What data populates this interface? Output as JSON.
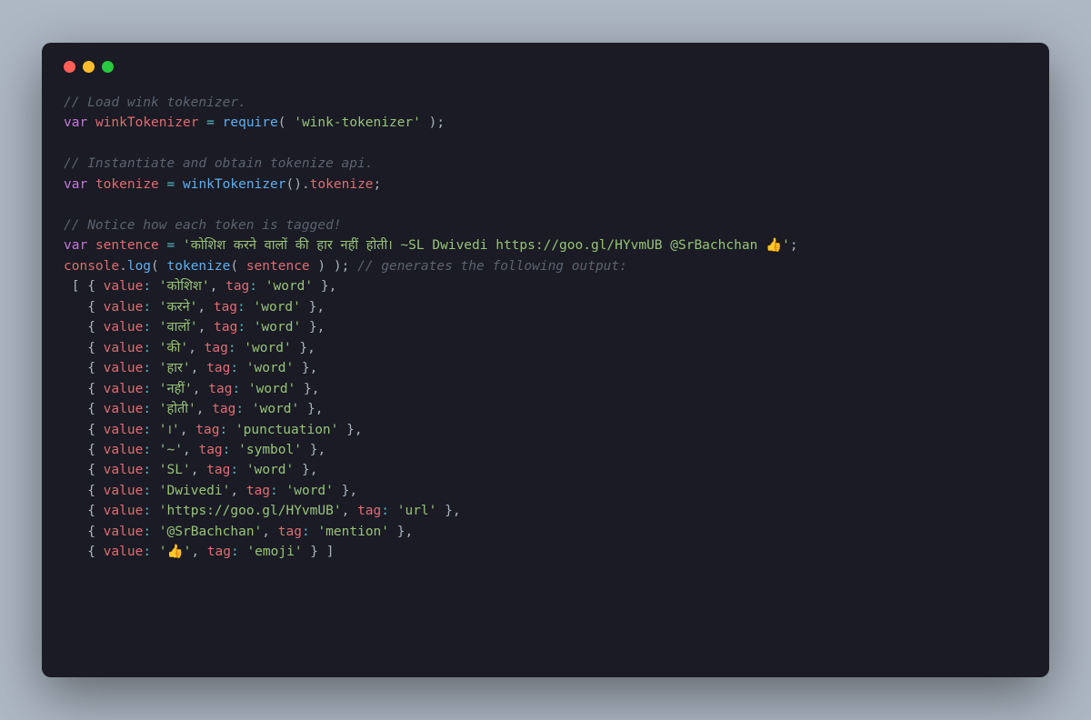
{
  "window": {
    "dots": [
      "red",
      "yellow",
      "green"
    ]
  },
  "code": {
    "c1": "// Load wink tokenizer.",
    "l2": {
      "kw": "var",
      "sp": " ",
      "v": "winkTokenizer",
      "eq": " = ",
      "fn": "require",
      "op": "( ",
      "str": "'wink-tokenizer'",
      "cp": " );"
    },
    "c3": "// Instantiate and obtain tokenize api.",
    "l4": {
      "kw": "var",
      "sp": " ",
      "v": "tokenize",
      "eq": " = ",
      "fn": "winkTokenizer",
      "call": "().",
      "prop": "tokenize",
      "end": ";"
    },
    "c5": "// Notice how each token is tagged!",
    "l6": {
      "kw": "var",
      "sp": " ",
      "v": "sentence",
      "eq": " = ",
      "str": "'कोशिश करने वालों की हार नहीं होती। ~SL Dwivedi https://goo.gl/HYvmUB @SrBachchan 👍'",
      "end": ";"
    },
    "l7": {
      "obj": "console",
      "dot": ".",
      "fn": "log",
      "op": "( ",
      "fn2": "tokenize",
      "op2": "( ",
      "arg": "sentence",
      "cp": " ) );",
      "sp": " ",
      "cmt": "// generates the following output:"
    },
    "out": {
      "open": " [ ",
      "rows": [
        {
          "v": "'कोशिश'",
          "t": "'word'"
        },
        {
          "v": "'करने'",
          "t": "'word'"
        },
        {
          "v": "'वालों'",
          "t": "'word'"
        },
        {
          "v": "'की'",
          "t": "'word'"
        },
        {
          "v": "'हार'",
          "t": "'word'"
        },
        {
          "v": "'नहीं'",
          "t": "'word'"
        },
        {
          "v": "'होती'",
          "t": "'word'"
        },
        {
          "v": "'।'",
          "t": "'punctuation'"
        },
        {
          "v": "'~'",
          "t": "'symbol'"
        },
        {
          "v": "'SL'",
          "t": "'word'"
        },
        {
          "v": "'Dwivedi'",
          "t": "'word'"
        },
        {
          "v": "'https://goo.gl/HYvmUB'",
          "t": "'url'"
        },
        {
          "v": "'@SrBachchan'",
          "t": "'mention'"
        },
        {
          "v": "'👍'",
          "t": "'emoji'"
        }
      ],
      "labels": {
        "value": "value",
        "tag": "tag",
        "sep": ": ",
        "comma": ", ",
        "open": "{ ",
        "close": " }",
        "lineEnd": ",",
        "lastEnd": " ]"
      }
    }
  }
}
